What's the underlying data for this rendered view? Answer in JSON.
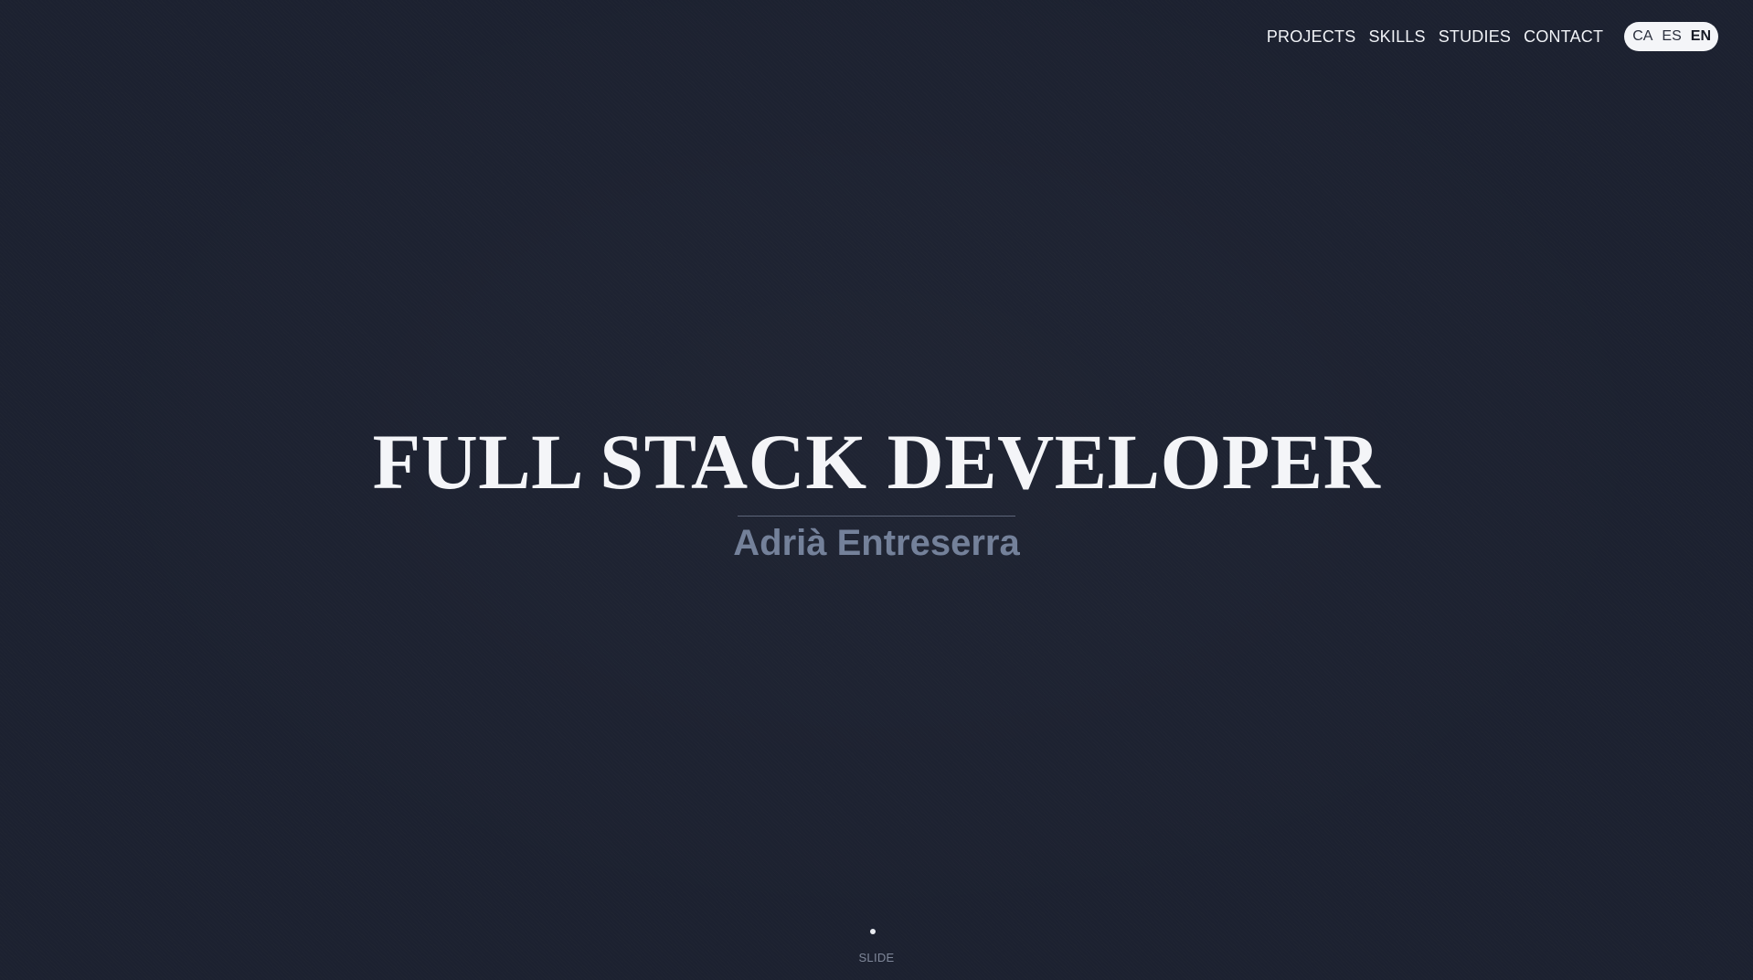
{
  "nav": {
    "links": [
      "PROJECTS",
      "SKILLS",
      "STUDIES",
      "CONTACT"
    ]
  },
  "languages": {
    "options": [
      "CA",
      "ES",
      "EN"
    ],
    "selected": "EN"
  },
  "hero": {
    "title": "FULL STACK DEVELOPER",
    "subtitle": "Adrià Entreserra"
  },
  "scroll_hint": {
    "label": "SLIDE"
  },
  "colors": {
    "background": "#1c2130",
    "title": "#f4f5f8",
    "subtitle": "#74819a",
    "divider": "#5d667a",
    "lang_pill": "#f4f5f8"
  }
}
